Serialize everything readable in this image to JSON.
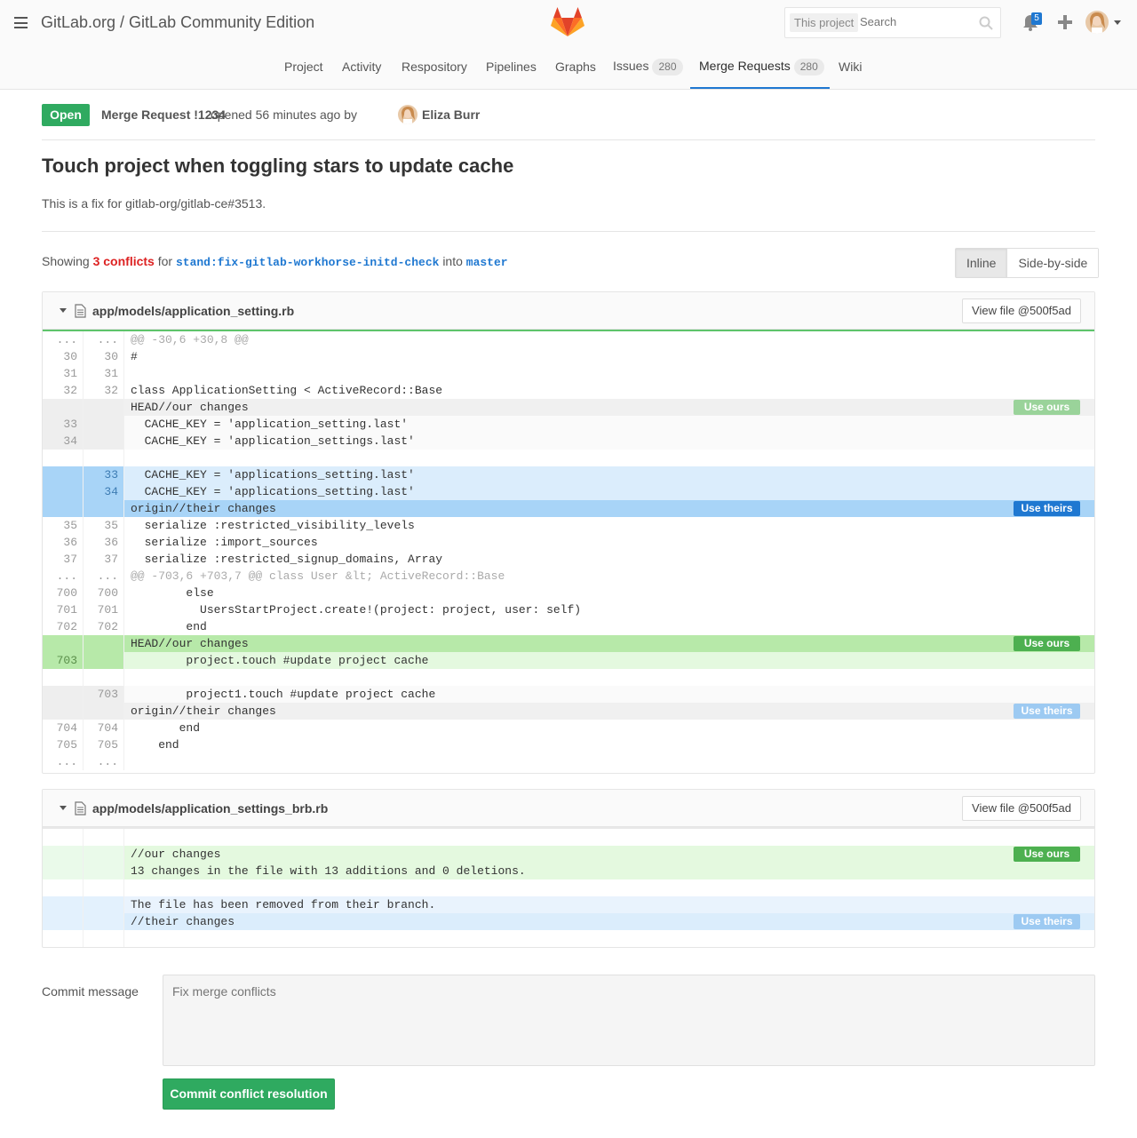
{
  "header": {
    "title": "GitLab.org / GitLab Community Edition",
    "search_scope": "This project",
    "search_placeholder": "Search",
    "notification_count": "5"
  },
  "nav": {
    "items": [
      {
        "label": "Project"
      },
      {
        "label": "Activity"
      },
      {
        "label": "Respository"
      },
      {
        "label": "Pipelines"
      },
      {
        "label": "Graphs"
      },
      {
        "label": "Issues",
        "count": "280"
      },
      {
        "label": "Merge Requests",
        "count": "280",
        "active": true
      },
      {
        "label": "Wiki"
      }
    ]
  },
  "mr": {
    "status": "Open",
    "id_label": "Merge Request !1234",
    "opened_text": "opened 56 minutes ago by",
    "author": "Eliza Burr",
    "title": "Touch project when toggling stars to update cache",
    "description": "This is a fix for gitlab-org/gitlab-ce#3513."
  },
  "summary": {
    "showing": "Showing",
    "conflicts": "3 conflicts",
    "for": "for",
    "source_branch": "stand:fix-gitlab-workhorse-initd-check",
    "into": "into",
    "target_branch": "master",
    "view_inline": "Inline",
    "view_side": "Side-by-side"
  },
  "files": [
    {
      "path": "app/models/application_setting.rb",
      "view_file": "View file @500f5ad",
      "rows": [
        {
          "l1": "...",
          "l2": "...",
          "code": "@@ -30,6 +30,8 @@",
          "type": "match"
        },
        {
          "l1": "30",
          "l2": "30",
          "code": "#",
          "type": "plain"
        },
        {
          "l1": "31",
          "l2": "31",
          "code": "",
          "type": "plain"
        },
        {
          "l1": "32",
          "l2": "32",
          "code": "class ApplicationSetting < ActiveRecord::Base",
          "type": "plain"
        },
        {
          "l1": "",
          "l2": "",
          "code": "HEAD//our changes",
          "type": "ourshead",
          "button": "Use ours",
          "btn": "ours-faded"
        },
        {
          "l1": "33",
          "l2": "",
          "code": "  CACHE_KEY = 'application_setting.last'",
          "type": "grey"
        },
        {
          "l1": "34",
          "l2": "",
          "code": "  CACHE_KEY = 'application_settings.last'",
          "type": "grey"
        },
        {
          "l1": "",
          "l2": "",
          "code": "",
          "type": "plain"
        },
        {
          "l1": "",
          "l2": "33",
          "code": "  CACHE_KEY = 'applications_setting.last'",
          "type": "blue"
        },
        {
          "l1": "",
          "l2": "34",
          "code": "  CACHE_KEY = 'applications_setting.last'",
          "type": "blue"
        },
        {
          "l1": "",
          "l2": "",
          "code": "origin//their changes",
          "type": "bluehead",
          "button": "Use theirs",
          "btn": "theirs"
        },
        {
          "l1": "35",
          "l2": "35",
          "code": "  serialize :restricted_visibility_levels",
          "type": "plain"
        },
        {
          "l1": "36",
          "l2": "36",
          "code": "  serialize :import_sources",
          "type": "plain"
        },
        {
          "l1": "37",
          "l2": "37",
          "code": "  serialize :restricted_signup_domains, Array",
          "type": "plain"
        },
        {
          "l1": "...",
          "l2": "...",
          "code": "@@ -703,6 +703,7 @@ class User &lt; ActiveRecord::Base",
          "type": "match"
        },
        {
          "l1": "700",
          "l2": "700",
          "code": "        else",
          "type": "plain"
        },
        {
          "l1": "701",
          "l2": "701",
          "code": "          UsersStartProject.create!(project: project, user: self)",
          "type": "plain"
        },
        {
          "l1": "702",
          "l2": "702",
          "code": "        end",
          "type": "plain"
        },
        {
          "l1": "",
          "l2": "",
          "code": "HEAD//our changes",
          "type": "greenhead",
          "button": "Use ours",
          "btn": "ours"
        },
        {
          "l1": "703",
          "l2": "",
          "code": "        project.touch #update project cache",
          "type": "green"
        },
        {
          "l1": "",
          "l2": "",
          "code": "",
          "type": "plain"
        },
        {
          "l1": "",
          "l2": "703",
          "code": "        project1.touch #update project cache",
          "type": "grey"
        },
        {
          "l1": "",
          "l2": "",
          "code": "origin//their changes",
          "type": "ourshead",
          "button": "Use theirs",
          "btn": "theirs-faded"
        },
        {
          "l1": "704",
          "l2": "704",
          "code": "       end",
          "type": "plain"
        },
        {
          "l1": "705",
          "l2": "705",
          "code": "    end",
          "type": "plain"
        },
        {
          "l1": "...",
          "l2": "...",
          "code": "",
          "type": "plain"
        }
      ]
    },
    {
      "path": "app/models/application_settings_brb.rb",
      "view_file": "View file @500f5ad",
      "rows": [
        {
          "l1": "",
          "l2": "",
          "code": "",
          "type": "plain"
        },
        {
          "l1": "",
          "l2": "",
          "code": "//our changes",
          "type": "lgreen",
          "button": "Use ours",
          "btn": "ours"
        },
        {
          "l1": "",
          "l2": "",
          "code": "13 changes in the file with 13 additions and 0 deletions.",
          "type": "lgreen"
        },
        {
          "l1": "",
          "l2": "",
          "code": "",
          "type": "plain"
        },
        {
          "l1": "",
          "l2": "",
          "code": "The file has been removed from their branch.",
          "type": "lblue"
        },
        {
          "l1": "",
          "l2": "",
          "code": "//their changes",
          "type": "lblue2",
          "button": "Use theirs",
          "btn": "theirs-faded"
        },
        {
          "l1": "",
          "l2": "",
          "code": "",
          "type": "plain"
        }
      ]
    }
  ],
  "commit": {
    "label": "Commit message",
    "placeholder": "Fix merge conflicts",
    "button": "Commit conflict resolution"
  },
  "colors": {
    "accent": "#1f78d1",
    "success": "#2faa60",
    "danger": "#dd2222"
  }
}
